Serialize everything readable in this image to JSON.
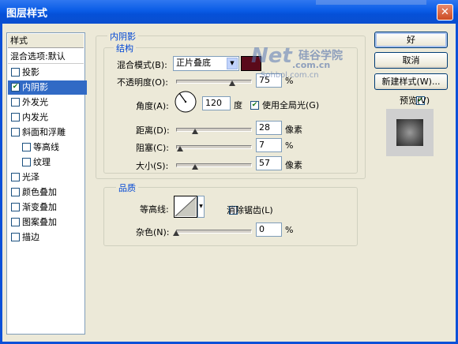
{
  "window": {
    "title": "图层样式",
    "close_icon": "✕"
  },
  "sidebar": {
    "header": "样式",
    "items": [
      {
        "label": "混合选项:默认",
        "kind": "plain"
      },
      {
        "label": "投影",
        "checked": false
      },
      {
        "label": "内阴影",
        "checked": true,
        "selected": true
      },
      {
        "label": "外发光",
        "checked": false
      },
      {
        "label": "内发光",
        "checked": false
      },
      {
        "label": "斜面和浮雕",
        "checked": false
      },
      {
        "label": "等高线",
        "checked": false,
        "indent": true
      },
      {
        "label": "纹理",
        "checked": false,
        "indent": true
      },
      {
        "label": "光泽",
        "checked": false
      },
      {
        "label": "颜色叠加",
        "checked": false
      },
      {
        "label": "渐变叠加",
        "checked": false
      },
      {
        "label": "图案叠加",
        "checked": false
      },
      {
        "label": "描边",
        "checked": false
      }
    ]
  },
  "inner_shadow": {
    "section_title": "内阴影",
    "structure": {
      "title": "结构",
      "blend_mode_label": "混合模式(B):",
      "blend_mode_value": "正片叠底",
      "opacity_label": "不透明度(O):",
      "opacity_value": "75",
      "opacity_unit": "%",
      "angle_label": "角度(A):",
      "angle_value": "120",
      "angle_unit": "度",
      "global_light_label": "使用全局光(G)",
      "global_light_checked": true,
      "distance_label": "距离(D):",
      "distance_value": "28",
      "distance_unit": "像素",
      "choke_label": "阻塞(C):",
      "choke_value": "7",
      "choke_unit": "%",
      "size_label": "大小(S):",
      "size_value": "57",
      "size_unit": "像素"
    },
    "quality": {
      "title": "品质",
      "contour_label": "等高线:",
      "anti_alias_label": "消除锯齿(L)",
      "anti_alias_checked": false,
      "noise_label": "杂色(N):",
      "noise_value": "0",
      "noise_unit": "%"
    }
  },
  "buttons": {
    "ok": "好",
    "cancel": "取消",
    "new_style": "新建样式(W)...",
    "preview_label": "预览(V)",
    "preview_checked": true
  },
  "watermark": {
    "brand": "Net",
    "site_cn": "硅谷学院",
    "domain": ".com.cn",
    "url_fragment": "Sohbol.com.cn"
  },
  "colors": {
    "title_bar": "#0a5ce6",
    "accent_text": "#0046d5",
    "selected_row": "#316ac5",
    "shadow_color": "#5a0a1a"
  }
}
